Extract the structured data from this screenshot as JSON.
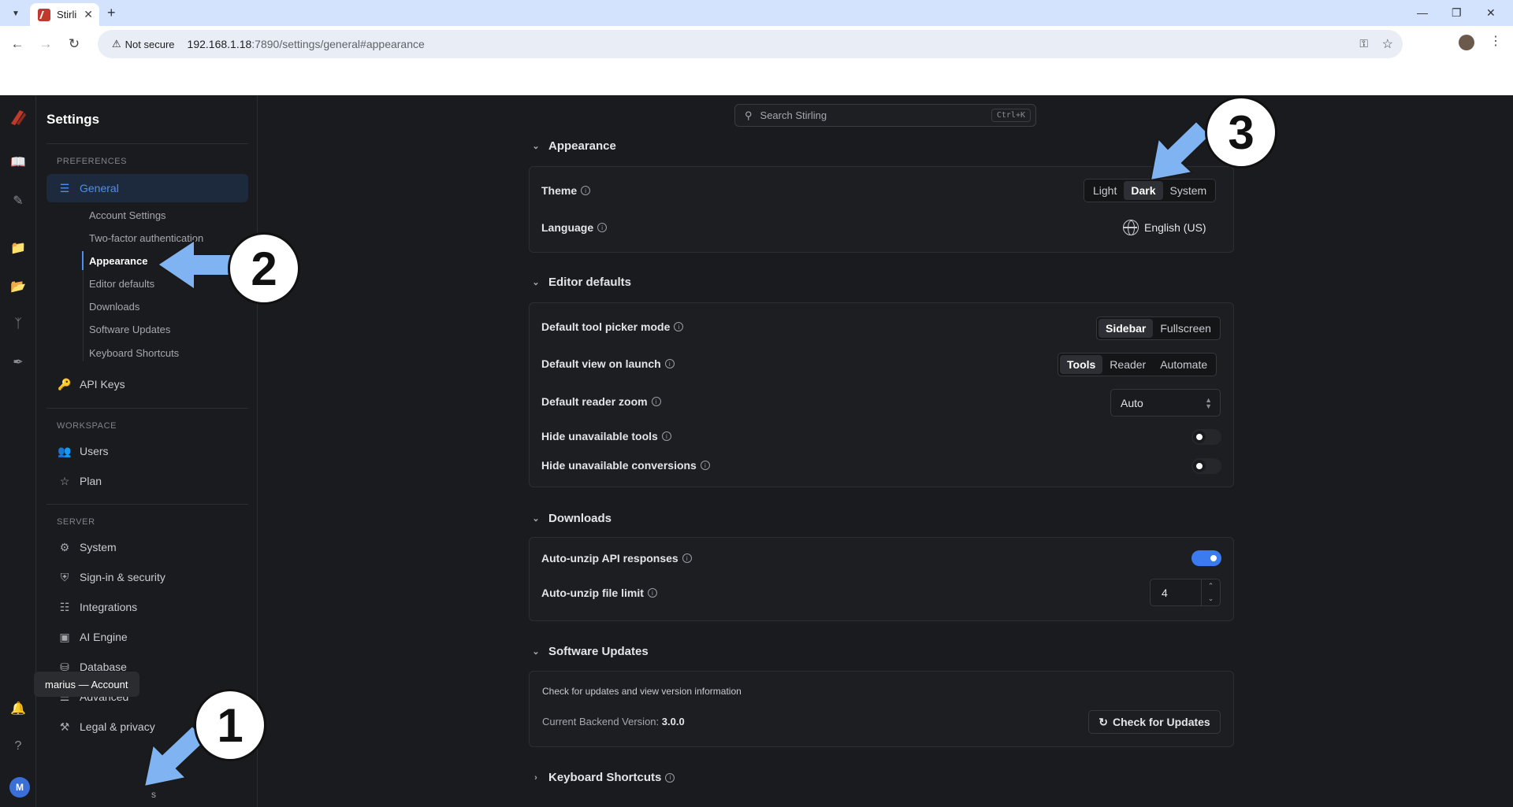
{
  "browser": {
    "tab_title": "Stirli",
    "not_secure": "Not secure",
    "url_host": "192.168.1.18",
    "url_rest": ":7890/settings/general#appearance"
  },
  "sidebar": {
    "title": "Settings",
    "section_preferences": "PREFERENCES",
    "general": "General",
    "sub_items": [
      "Account Settings",
      "Two-factor authentication",
      "Appearance",
      "Editor defaults",
      "Downloads",
      "Software Updates",
      "Keyboard Shortcuts"
    ],
    "api_keys": "API Keys",
    "section_workspace": "WORKSPACE",
    "users": "Users",
    "plan": "Plan",
    "section_server": "SERVER",
    "system": "System",
    "signin": "Sign-in & security",
    "integrations": "Integrations",
    "ai_engine": "AI Engine",
    "database": "Database",
    "advanced": "Advanced",
    "legal": "Legal & privacy",
    "avatar_letter": "M",
    "account_label": "marius — Account",
    "account_trailing": "s"
  },
  "search": {
    "placeholder": "Search Stirling",
    "shortcut": "Ctrl+K"
  },
  "appearance": {
    "header": "Appearance",
    "theme_label": "Theme",
    "theme_options": [
      "Light",
      "Dark",
      "System"
    ],
    "theme_selected": "Dark",
    "language_label": "Language",
    "language_value": "English (US)"
  },
  "editor": {
    "header": "Editor defaults",
    "picker_label": "Default tool picker mode",
    "picker_options": [
      "Sidebar",
      "Fullscreen"
    ],
    "view_label": "Default view on launch",
    "view_options": [
      "Tools",
      "Reader",
      "Automate"
    ],
    "zoom_label": "Default reader zoom",
    "zoom_value": "Auto",
    "hide_tools_label": "Hide unavailable tools",
    "hide_tools_on": false,
    "hide_conv_label": "Hide unavailable conversions",
    "hide_conv_on": false
  },
  "downloads": {
    "header": "Downloads",
    "unzip_label": "Auto-unzip API responses",
    "unzip_on": true,
    "limit_label": "Auto-unzip file limit",
    "limit_value": "4"
  },
  "updates": {
    "header": "Software Updates",
    "desc": "Check for updates and view version information",
    "version_label": "Current Backend Version:",
    "version_value": "3.0.0",
    "check_button": "Check for Updates"
  },
  "shortcuts": {
    "header": "Keyboard Shortcuts"
  },
  "annotations": {
    "badge1": "1",
    "badge2": "2",
    "badge3": "3"
  },
  "colors": {
    "accent": "#3b7bf0",
    "annotation_arrow": "#7fb3f2"
  }
}
